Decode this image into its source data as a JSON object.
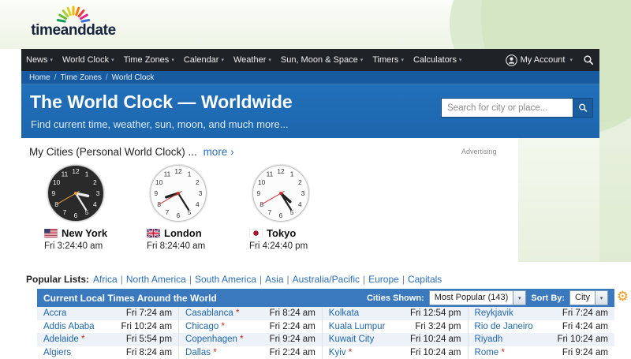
{
  "icons": {
    "caret_down": "▾",
    "slash": "/",
    "pipe": "|",
    "gear": "⚙"
  },
  "logo": {
    "text": "timeanddate"
  },
  "nav": {
    "items": [
      {
        "id": "news",
        "label": "News"
      },
      {
        "id": "world-clock",
        "label": "World Clock"
      },
      {
        "id": "time-zones",
        "label": "Time Zones"
      },
      {
        "id": "calendar",
        "label": "Calendar"
      },
      {
        "id": "weather",
        "label": "Weather"
      },
      {
        "id": "sun-moon-space",
        "label": "Sun, Moon & Space"
      },
      {
        "id": "timers",
        "label": "Timers"
      },
      {
        "id": "calculators",
        "label": "Calculators"
      }
    ],
    "account_label": "My Account"
  },
  "breadcrumb": {
    "items": [
      "Home",
      "Time Zones",
      "World Clock"
    ]
  },
  "hero": {
    "title": "The World Clock — Worldwide",
    "subtitle": "Find current time, weather, sun, moon, and much more...",
    "search_placeholder": "Search for city or place..."
  },
  "my_cities": {
    "heading": "My Cities (Personal World Clock) ...",
    "more_label": "more ›",
    "advertising_label": "Advertising",
    "clock_numerals": [
      1,
      2,
      3,
      4,
      5,
      6,
      7,
      8,
      9,
      10,
      11,
      12
    ],
    "clocks": [
      {
        "city": "New York",
        "time": "Fri 3:24:40 am",
        "flag": "United States",
        "face": "dark",
        "hour_deg": 102,
        "minute_deg": 148,
        "second_deg": 240
      },
      {
        "city": "London",
        "time": "Fri 8:24:40 am",
        "flag": "United Kingdom",
        "face": "light",
        "hour_deg": 252,
        "minute_deg": 148,
        "second_deg": 240
      },
      {
        "city": "Tokyo",
        "time": "Fri 4:24:40 pm",
        "flag": "Japan",
        "face": "light",
        "hour_deg": 132,
        "minute_deg": 148,
        "second_deg": 240
      }
    ]
  },
  "popular": {
    "label": "Popular Lists:",
    "links": [
      "Africa",
      "North America",
      "South America",
      "Asia",
      "Australia/Pacific",
      "Europe",
      "Capitals"
    ]
  },
  "table": {
    "title": "Current Local Times Around the World",
    "cities_shown_label": "Cities Shown:",
    "cities_shown_value": "Most Popular (143)",
    "sort_by_label": "Sort By:",
    "sort_by_value": "City",
    "rows": [
      [
        {
          "city": "Accra",
          "time": "Fri 7:24 am",
          "dst": false
        },
        {
          "city": "Casablanca",
          "time": "Fri 8:24 am",
          "dst": true
        },
        {
          "city": "Kolkata",
          "time": "Fri 12:54 pm",
          "dst": false
        },
        {
          "city": "Reykjavik",
          "time": "Fri 7:24 am",
          "dst": false
        }
      ],
      [
        {
          "city": "Addis Ababa",
          "time": "Fri 10:24 am",
          "dst": false
        },
        {
          "city": "Chicago",
          "time": "Fri 2:24 am",
          "dst": true
        },
        {
          "city": "Kuala Lumpur",
          "time": "Fri 3:24 pm",
          "dst": false
        },
        {
          "city": "Rio de Janeiro",
          "time": "Fri 4:24 am",
          "dst": false
        }
      ],
      [
        {
          "city": "Adelaide",
          "time": "Fri 5:54 pm",
          "dst": true
        },
        {
          "city": "Copenhagen",
          "time": "Fri 9:24 am",
          "dst": true
        },
        {
          "city": "Kuwait City",
          "time": "Fri 10:24 am",
          "dst": false
        },
        {
          "city": "Riyadh",
          "time": "Fri 10:24 am",
          "dst": false
        }
      ],
      [
        {
          "city": "Algiers",
          "time": "Fri 8:24 am",
          "dst": false
        },
        {
          "city": "Dallas",
          "time": "Fri 2:24 am",
          "dst": true
        },
        {
          "city": "Kyiv",
          "time": "Fri 10:24 am",
          "dst": true
        },
        {
          "city": "Rome",
          "time": "Fri 9:24 am",
          "dst": true
        }
      ]
    ]
  }
}
